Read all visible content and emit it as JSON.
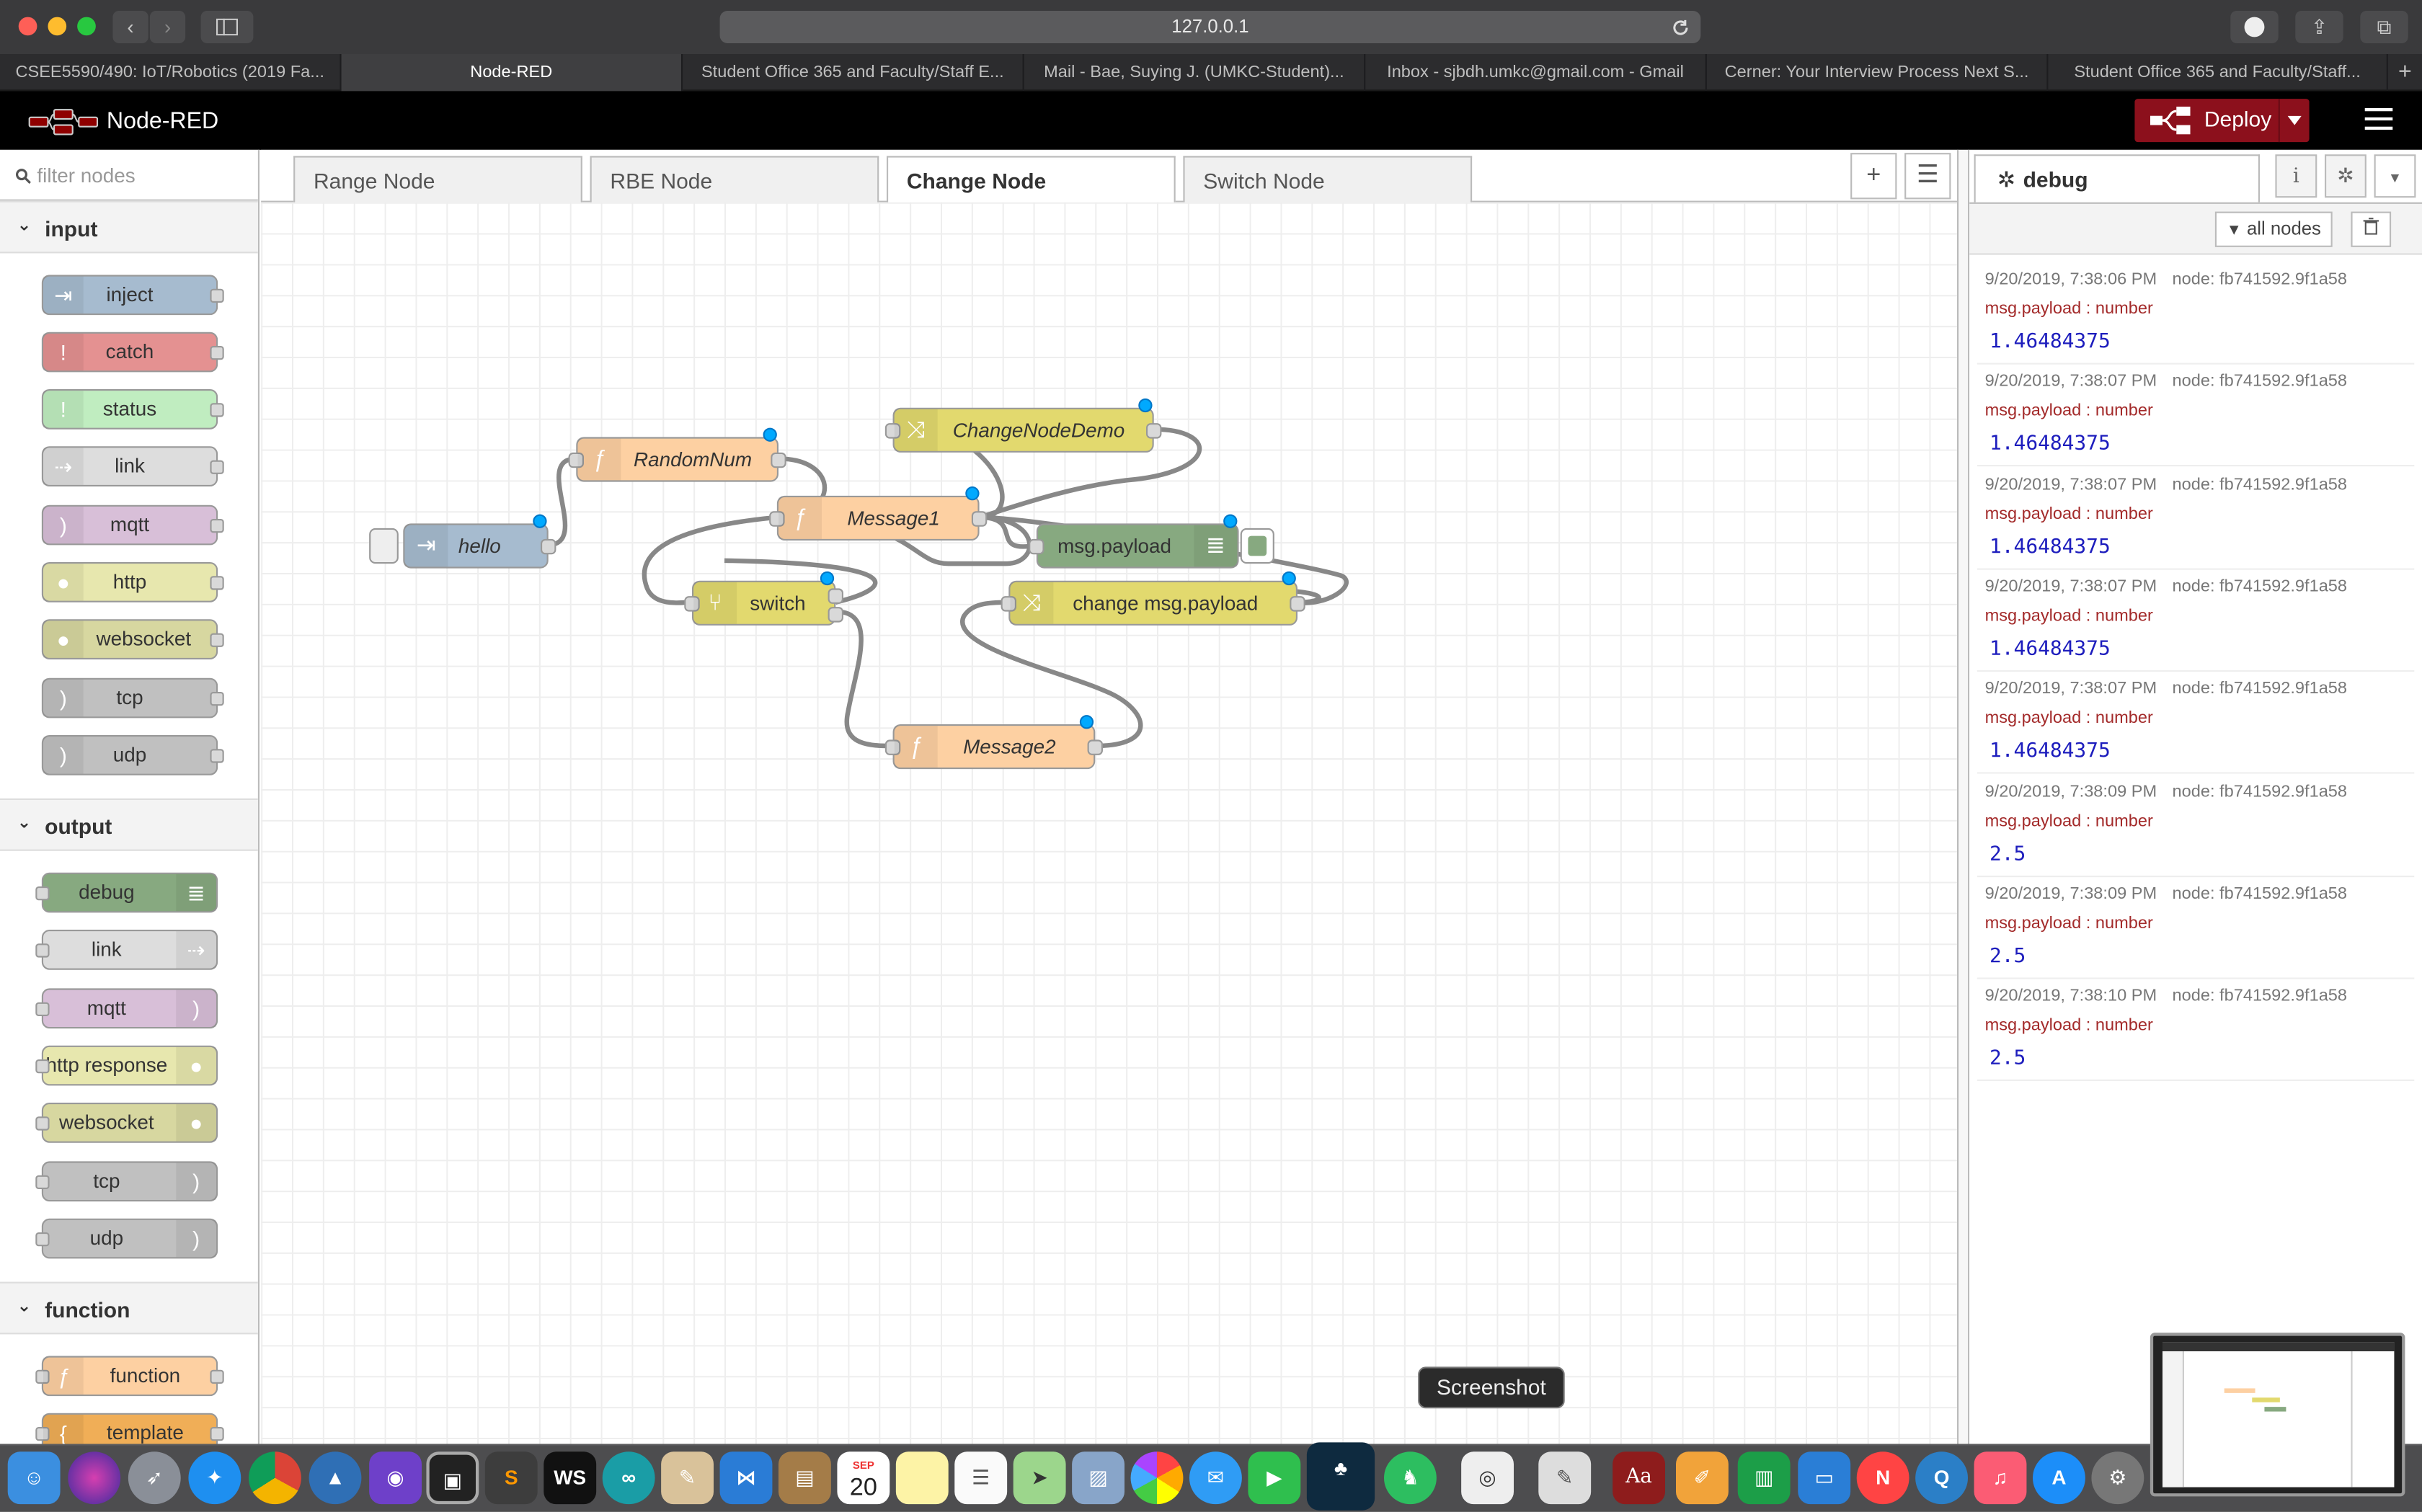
{
  "browser": {
    "url": "127.0.0.1",
    "tabs": [
      {
        "label": "CSEE5590/490: IoT/Robotics (2019 Fa..."
      },
      {
        "label": "Node-RED"
      },
      {
        "label": "Student Office 365 and Faculty/Staff E..."
      },
      {
        "label": "Mail - Bae, Suying J. (UMKC-Student)..."
      },
      {
        "label": "Inbox - sjbdh.umkc@gmail.com - Gmail"
      },
      {
        "label": "Cerner: Your Interview Process Next S..."
      },
      {
        "label": "Student Office 365 and Faculty/Staff..."
      }
    ],
    "new_tab": "+"
  },
  "header": {
    "title": "Node-RED",
    "deploy_label": "Deploy"
  },
  "palette": {
    "filter_placeholder": "filter nodes",
    "categories": [
      {
        "name": "input",
        "nodes": [
          "inject",
          "catch",
          "status",
          "link",
          "mqtt",
          "http",
          "websocket",
          "tcp",
          "udp"
        ]
      },
      {
        "name": "output",
        "nodes": [
          "debug",
          "link",
          "mqtt",
          "http response",
          "websocket",
          "tcp",
          "udp"
        ]
      },
      {
        "name": "function",
        "nodes": [
          "function",
          "template"
        ]
      }
    ]
  },
  "workspace": {
    "tabs": [
      "Range Node",
      "RBE Node",
      "Change Node",
      "Switch Node"
    ],
    "active_tab": "Change Node",
    "flow_nodes": {
      "hello": "hello",
      "randomnum": "RandomNum",
      "changenodedemo": "ChangeNodeDemo",
      "message1": "Message1",
      "msgpayload": "msg.payload",
      "switch": "switch",
      "changemsgpayload": "change msg.payload",
      "message2": "Message2"
    }
  },
  "sidebar": {
    "tab_label": "debug",
    "filter_label": "all nodes",
    "messages": [
      {
        "time": "9/20/2019, 7:38:06 PM",
        "node": "node: fb741592.9f1a58",
        "topic": "msg.payload : number",
        "value": "1.46484375"
      },
      {
        "time": "9/20/2019, 7:38:07 PM",
        "node": "node: fb741592.9f1a58",
        "topic": "msg.payload : number",
        "value": "1.46484375"
      },
      {
        "time": "9/20/2019, 7:38:07 PM",
        "node": "node: fb741592.9f1a58",
        "topic": "msg.payload : number",
        "value": "1.46484375"
      },
      {
        "time": "9/20/2019, 7:38:07 PM",
        "node": "node: fb741592.9f1a58",
        "topic": "msg.payload : number",
        "value": "1.46484375"
      },
      {
        "time": "9/20/2019, 7:38:07 PM",
        "node": "node: fb741592.9f1a58",
        "topic": "msg.payload : number",
        "value": "1.46484375"
      },
      {
        "time": "9/20/2019, 7:38:09 PM",
        "node": "node: fb741592.9f1a58",
        "topic": "msg.payload : number",
        "value": "2.5"
      },
      {
        "time": "9/20/2019, 7:38:09 PM",
        "node": "node: fb741592.9f1a58",
        "topic": "msg.payload : number",
        "value": "2.5"
      },
      {
        "time": "9/20/2019, 7:38:10 PM",
        "node": "node: fb741592.9f1a58",
        "topic": "msg.payload : number",
        "value": "2.5"
      }
    ]
  },
  "dock": {
    "tooltip": "Screenshot",
    "calendar_month": "SEP",
    "calendar_day": "20",
    "ws_label": "WS",
    "dictionary_label": "Aa"
  }
}
